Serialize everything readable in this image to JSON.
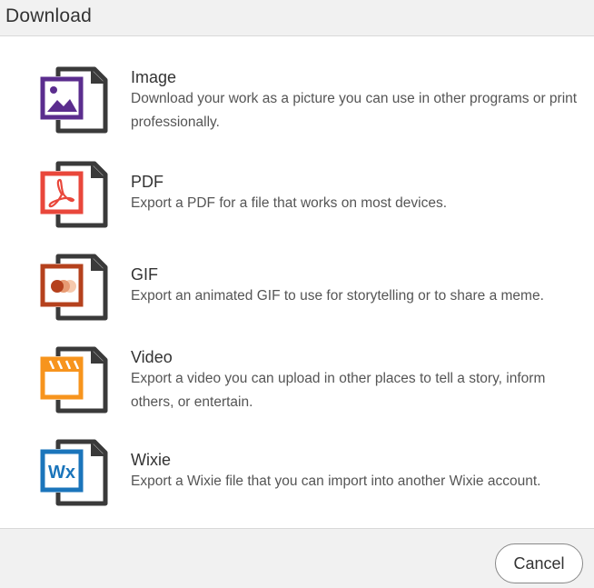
{
  "dialog": {
    "title": "Download"
  },
  "options": [
    {
      "id": "image",
      "title": "Image",
      "description": "Download your work as a picture you can use in other programs or print professionally.",
      "icon": "image-file-icon",
      "color": "#5b2d8e"
    },
    {
      "id": "pdf",
      "title": "PDF",
      "description": "Export a PDF for a file that works on most devices.",
      "icon": "pdf-file-icon",
      "color": "#e9473b"
    },
    {
      "id": "gif",
      "title": "GIF",
      "description": "Export an animated GIF to use for storytelling or to share a meme.",
      "icon": "gif-file-icon",
      "color": "#b5411d"
    },
    {
      "id": "video",
      "title": "Video",
      "description": "Export a video you can upload in other places to tell a story, inform others, or entertain.",
      "icon": "video-file-icon",
      "color": "#f7941d"
    },
    {
      "id": "wixie",
      "title": "Wixie",
      "description": "Export a Wixie file that you can import into another Wixie account.",
      "icon": "wixie-file-icon",
      "color": "#1b75bb",
      "icon_text": "Wx"
    }
  ],
  "footer": {
    "cancel_label": "Cancel"
  }
}
